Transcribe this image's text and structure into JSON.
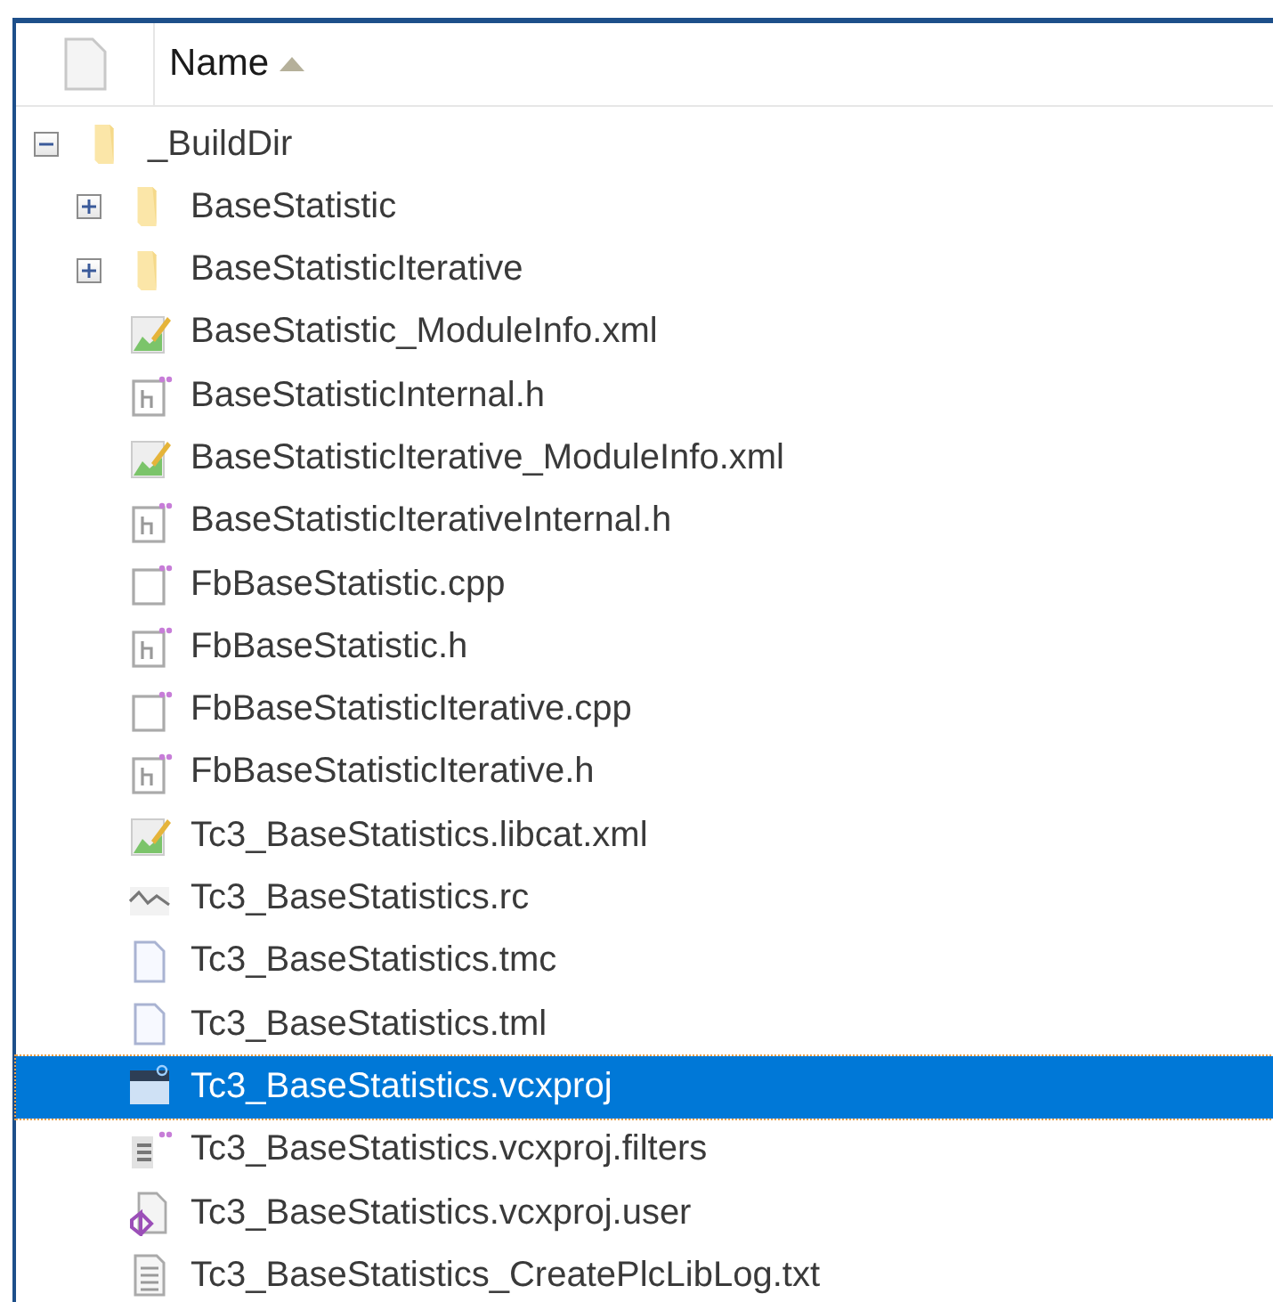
{
  "header": {
    "column": "Name",
    "sorted_ascending": true
  },
  "tree": [
    {
      "name": "_BuildDir",
      "kind": "folder",
      "expanded": true,
      "selected": false,
      "children": [
        {
          "name": "BaseStatistic",
          "kind": "folder",
          "expanded": false,
          "selected": false
        },
        {
          "name": "BaseStatisticIterative",
          "kind": "folder",
          "expanded": false,
          "selected": false
        },
        {
          "name": "BaseStatistic_ModuleInfo.xml",
          "kind": "xml",
          "selected": false
        },
        {
          "name": "BaseStatisticInternal.h",
          "kind": "header",
          "selected": false
        },
        {
          "name": "BaseStatisticIterative_ModuleInfo.xml",
          "kind": "xml",
          "selected": false
        },
        {
          "name": "BaseStatisticIterativeInternal.h",
          "kind": "header",
          "selected": false
        },
        {
          "name": "FbBaseStatistic.cpp",
          "kind": "source",
          "selected": false
        },
        {
          "name": "FbBaseStatistic.h",
          "kind": "header",
          "selected": false
        },
        {
          "name": "FbBaseStatisticIterative.cpp",
          "kind": "source",
          "selected": false
        },
        {
          "name": "FbBaseStatisticIterative.h",
          "kind": "header",
          "selected": false
        },
        {
          "name": "Tc3_BaseStatistics.libcat.xml",
          "kind": "xml",
          "selected": false
        },
        {
          "name": "Tc3_BaseStatistics.rc",
          "kind": "resource",
          "selected": false
        },
        {
          "name": "Tc3_BaseStatistics.tmc",
          "kind": "document",
          "selected": false
        },
        {
          "name": "Tc3_BaseStatistics.tml",
          "kind": "document",
          "selected": false
        },
        {
          "name": "Tc3_BaseStatistics.vcxproj",
          "kind": "project",
          "selected": true
        },
        {
          "name": "Tc3_BaseStatistics.vcxproj.filters",
          "kind": "filters",
          "selected": false
        },
        {
          "name": "Tc3_BaseStatistics.vcxproj.user",
          "kind": "user",
          "selected": false
        },
        {
          "name": "Tc3_BaseStatistics_CreatePlcLibLog.txt",
          "kind": "text",
          "selected": false
        }
      ]
    }
  ]
}
